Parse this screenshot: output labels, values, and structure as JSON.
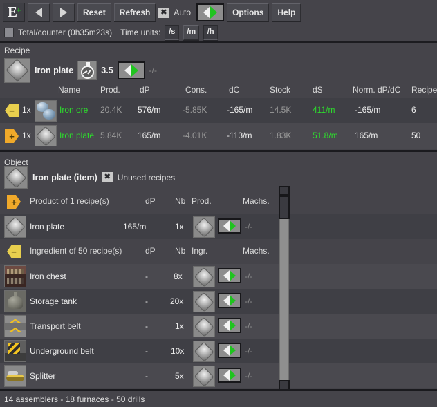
{
  "toolbar": {
    "logo_glyph": "E",
    "logo_plus": "+",
    "back_icon": "triangle-left-icon",
    "forward_icon": "triangle-right-icon",
    "reset_label": "Reset",
    "refresh_label": "Refresh",
    "auto_checkbox_glyph": "✖",
    "auto_label": "Auto",
    "direction_toggle_icon": "left-right-arrow-toggle-icon",
    "options_label": "Options",
    "help_label": "Help"
  },
  "options_row": {
    "total_counter_label": "Total/counter (0h35m23s)",
    "time_units_label": "Time units:",
    "time_units": [
      {
        "label": "/s",
        "selected": false
      },
      {
        "label": "/m",
        "selected": true
      },
      {
        "label": "/h",
        "selected": false
      }
    ]
  },
  "recipe_panel": {
    "title": "Recipe",
    "item_icon": "iron-plate-icon",
    "item_name": "Iron plate",
    "time_icon": "stopwatch-icon",
    "time_value": "3.5",
    "toggle_icon": "left-right-arrow-toggle-icon",
    "machines_value": "-/-",
    "columns": [
      "Name",
      "Prod.",
      "dP",
      "Cons.",
      "dC",
      "Stock",
      "dS",
      "Norm. dP/dC",
      "Recipes"
    ],
    "rows": [
      {
        "direction": "ingredient",
        "direction_icon": "ingredient-minus-arrow-icon",
        "direction_sign": "−",
        "amount": "1x",
        "icon": "iron-ore-icon",
        "name": "Iron ore",
        "prod": "20.4K",
        "dp": "576/m",
        "cons": "-5.85K",
        "dc": "-165/m",
        "stock": "14.5K",
        "ds": "411/m",
        "norm": "-165/m",
        "recipes": "6"
      },
      {
        "direction": "product",
        "direction_icon": "product-plus-arrow-icon",
        "direction_sign": "+",
        "amount": "1x",
        "icon": "iron-plate-icon",
        "name": "Iron plate",
        "prod": "5.84K",
        "dp": "165/m",
        "cons": "-4.01K",
        "dc": "-113/m",
        "stock": "1.83K",
        "ds": "51.8/m",
        "norm": "165/m",
        "recipes": "50"
      }
    ]
  },
  "object_panel": {
    "title": "Object",
    "item_icon": "iron-plate-icon",
    "item_name": "Iron plate (item)",
    "unused_checkbox_glyph": "✖",
    "unused_label": "Unused recipes",
    "product_section": {
      "direction_icon": "product-plus-arrow-icon",
      "direction_sign": "+",
      "label": "Product of 1 recipe(s)",
      "columns": [
        "dP",
        "Nb",
        "Prod.",
        "Machs."
      ],
      "rows": [
        {
          "icon": "iron-plate-icon",
          "name": "Iron plate",
          "dp": "165/m",
          "nb": "1x",
          "prod_icon": "iron-plate-icon",
          "toggle_icon": "left-right-arrow-toggle-icon",
          "machs": "-/-"
        }
      ]
    },
    "ingredient_section": {
      "direction_icon": "ingredient-minus-arrow-icon",
      "direction_sign": "−",
      "label": "Ingredient of 50 recipe(s)",
      "columns": [
        "dP",
        "Nb",
        "Ingr.",
        "Machs."
      ],
      "rows": [
        {
          "icon": "iron-chest-icon",
          "name": "Iron chest",
          "dp": "-",
          "nb": "8x",
          "ingr_icon": "iron-plate-icon",
          "toggle_icon": "left-right-arrow-toggle-icon",
          "machs": "-/-"
        },
        {
          "icon": "storage-tank-icon",
          "name": "Storage tank",
          "dp": "-",
          "nb": "20x",
          "ingr_icon": "iron-plate-icon",
          "toggle_icon": "left-right-arrow-toggle-icon",
          "machs": "-/-"
        },
        {
          "icon": "transport-belt-icon",
          "name": "Transport belt",
          "dp": "-",
          "nb": "1x",
          "ingr_icon": "iron-plate-icon",
          "toggle_icon": "left-right-arrow-toggle-icon",
          "machs": "-/-"
        },
        {
          "icon": "underground-belt-icon",
          "name": "Underground belt",
          "dp": "-",
          "nb": "10x",
          "ingr_icon": "iron-plate-icon",
          "toggle_icon": "left-right-arrow-toggle-icon",
          "machs": "-/-"
        },
        {
          "icon": "splitter-icon",
          "name": "Splitter",
          "dp": "-",
          "nb": "5x",
          "ingr_icon": "iron-plate-icon",
          "toggle_icon": "left-right-arrow-toggle-icon",
          "machs": "-/-"
        }
      ]
    },
    "scrollbar": "vertical-scrollbar"
  },
  "statusbar": {
    "text": "14 assemblers -  18 furnaces -  50 drills"
  },
  "colors": {
    "background": "#45444a",
    "band_dark": "#3f3f45",
    "band_light": "#4a494f",
    "accent_green": "#2ddc2d",
    "accent_yellow": "#e8cf4e",
    "accent_orange": "#f0a92a",
    "text": "#d8d8d8",
    "text_dim": "#9a9a9a"
  }
}
